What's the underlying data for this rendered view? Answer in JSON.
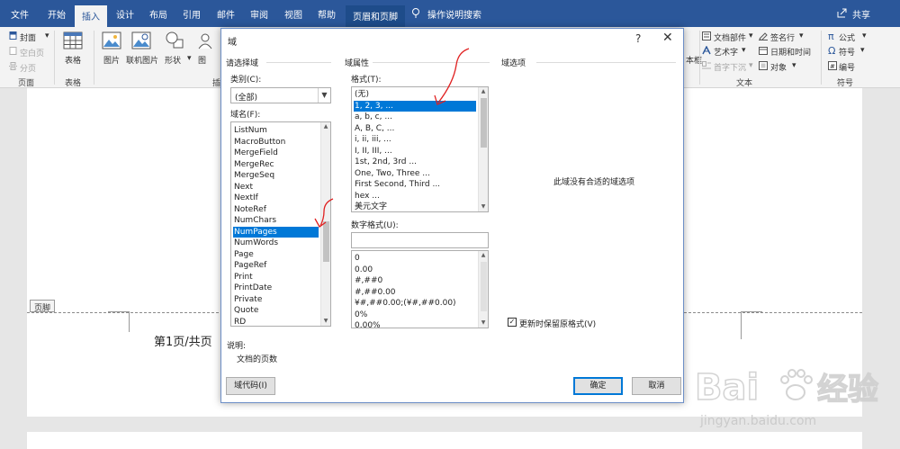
{
  "tabs": {
    "items": [
      "文件",
      "开始",
      "插入",
      "设计",
      "布局",
      "引用",
      "邮件",
      "审阅",
      "视图",
      "帮助",
      "页眉和页脚"
    ],
    "search": "操作说明搜索",
    "share": "共享"
  },
  "ribbon": {
    "cover": "封面",
    "blank_page": "空白页",
    "page_break": "分页",
    "group_pages": "页面",
    "table": "表格",
    "group_table": "表格",
    "picture": "图片",
    "online_picture": "联机图片",
    "shapes": "形状",
    "icons": "图",
    "group_illus": "插",
    "textbox": "本框",
    "quick_parts": "文档部件",
    "wordart": "艺术字",
    "dropcap": "首字下沉",
    "signature": "签名行",
    "datetime": "日期和时间",
    "object": "对象",
    "group_text": "文本",
    "equation": "公式",
    "symbol": "符号",
    "number": "编号",
    "group_symbols": "符号"
  },
  "document": {
    "footer_tag": "页脚",
    "footer_text": "第1页/共页"
  },
  "dialog": {
    "title": "域",
    "help": "?",
    "close": "✕",
    "choose_field": "请选择域",
    "categories_label": "类别(C):",
    "category_value": "(全部)",
    "field_names_label": "域名(F):",
    "field_names": [
      "ListNum",
      "MacroButton",
      "MergeField",
      "MergeRec",
      "MergeSeq",
      "Next",
      "NextIf",
      "NoteRef",
      "NumChars",
      "NumPages",
      "NumWords",
      "Page",
      "PageRef",
      "Print",
      "PrintDate",
      "Private",
      "Quote",
      "RD"
    ],
    "field_selected": "NumPages",
    "field_properties": "域属性",
    "format_label": "格式(T):",
    "formats": [
      "(无)",
      "1, 2, 3, ...",
      "a, b, c, ...",
      "A, B, C, ...",
      "i, ii, iii, ...",
      "I, II, III, ...",
      "1st, 2nd, 3rd ...",
      "One, Two, Three ...",
      "First Second, Third ...",
      "hex ...",
      "美元文字"
    ],
    "format_selected": "1, 2, 3, ...",
    "numeric_format_label": "数字格式(U):",
    "numeric_formats": [
      "0",
      "0.00",
      "#,##0",
      "#,##0.00",
      "¥#,##0.00;(¥#,##0.00)",
      "0%",
      "0.00%"
    ],
    "field_options": "域选项",
    "no_options": "此域没有合适的域选项",
    "preserve_format": "更新时保留原格式(V)",
    "preserve_checked": "✓",
    "description_label": "说明:",
    "description": "文档的页数",
    "field_codes_button": "域代码(I)",
    "ok_button": "确定",
    "cancel_button": "取消"
  },
  "watermark": {
    "brand": "Bai",
    "brand2": "经验",
    "url": "jingyan.baidu.com"
  },
  "colors": {
    "title_bar": "#2b579a",
    "selection": "#0078d7",
    "annotation": "#e02020"
  }
}
